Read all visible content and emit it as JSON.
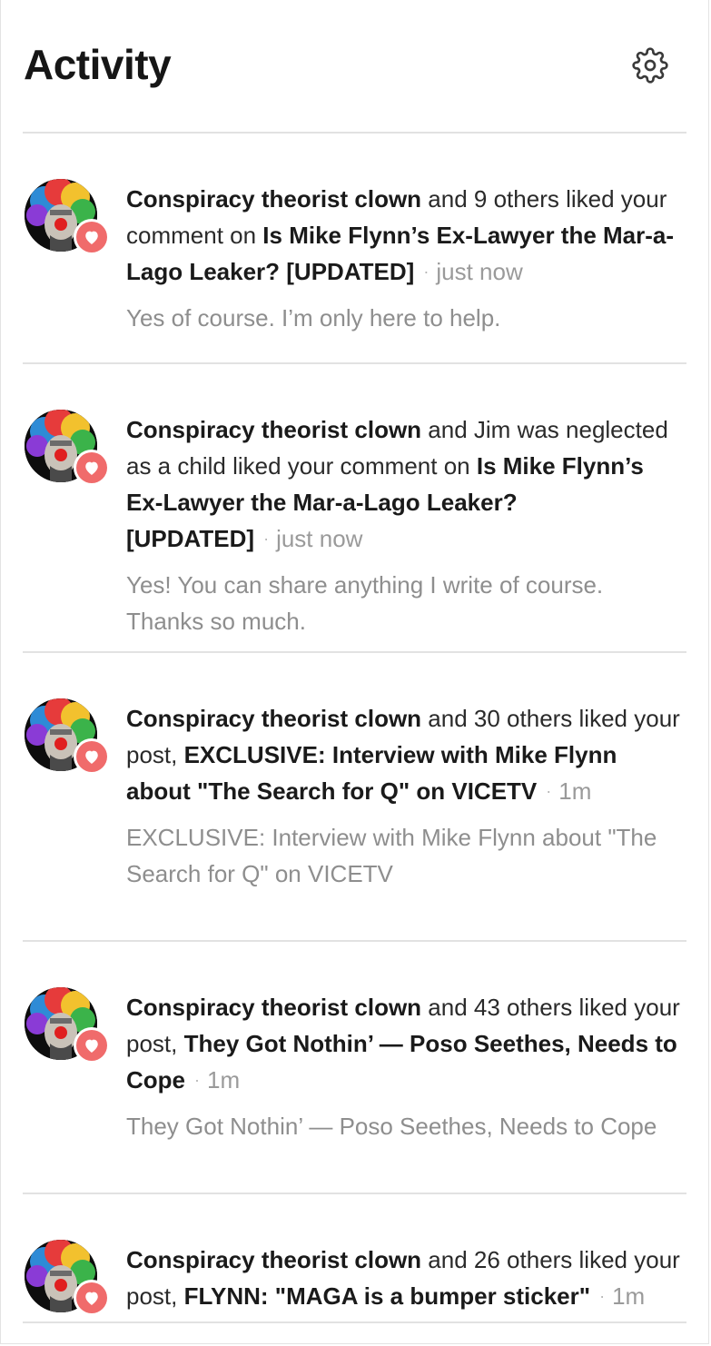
{
  "header": {
    "title": "Activity",
    "settings_icon": "gear-icon"
  },
  "accent_color": "#f06b6b",
  "items": [
    {
      "actor": "Conspiracy theorist clown",
      "middle": " and 9 others liked your comment on ",
      "target": "Is Mike Flynn’s Ex-Lawyer the Mar-a-Lago Leaker? [UPDATED]",
      "separator": "·",
      "time": "just now",
      "snippet": "Yes of course. I’m only here to help."
    },
    {
      "actor": "Conspiracy theorist clown",
      "middle": " and Jim was neglected as a child liked your comment on ",
      "target": "Is Mike Flynn’s Ex-Lawyer the Mar-a-Lago Leaker? [UPDATED]",
      "separator": "·",
      "time": "just now",
      "snippet": "Yes! You can share anything I write of course. Thanks so much."
    },
    {
      "actor": "Conspiracy theorist clown",
      "middle": " and 30 others liked your post, ",
      "target": "EXCLUSIVE: Interview with Mike Flynn about \"The Search for Q\" on VICETV",
      "separator": "·",
      "time": "1m",
      "snippet": "EXCLUSIVE: Interview with Mike Flynn about \"The Search for Q\" on VICETV"
    },
    {
      "actor": "Conspiracy theorist clown",
      "middle": " and 43 others liked your post, ",
      "target": "They Got Nothin’ — Poso Seethes, Needs to Cope",
      "separator": "·",
      "time": "1m",
      "snippet": "They Got Nothin’ — Poso Seethes, Needs to Cope"
    },
    {
      "actor": "Conspiracy theorist clown",
      "middle": " and 26 others liked your post, ",
      "target": "FLYNN: \"MAGA is a bumper sticker\"",
      "separator": "·",
      "time": "1m",
      "snippet": ""
    }
  ]
}
